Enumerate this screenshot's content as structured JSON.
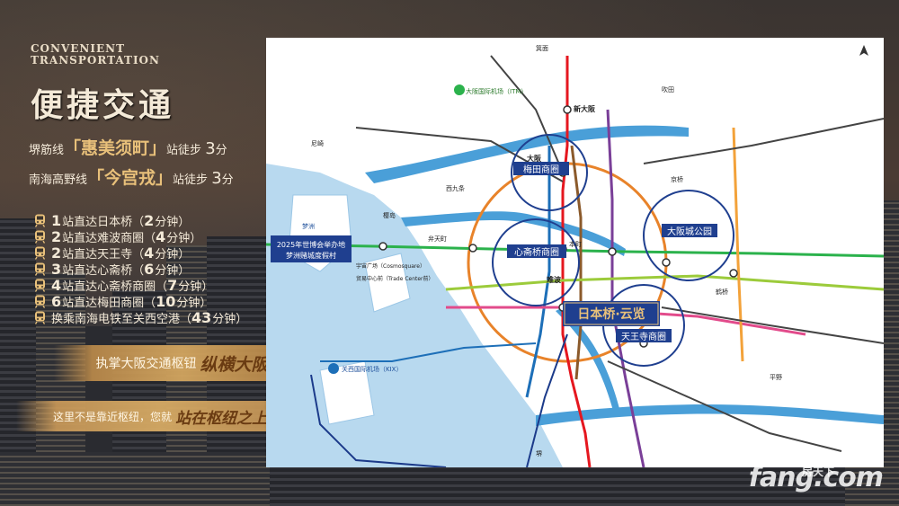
{
  "header": {
    "en_title_line1": "CONVENIENT",
    "en_title_line2": "TRANSPORTATION",
    "cn_title": "便捷交通"
  },
  "lines": [
    {
      "prefix": "堺筋线",
      "station": "「惠美须町」",
      "suffix": "站徒步",
      "minutes": "3",
      "unit": "分"
    },
    {
      "prefix": "南海高野线",
      "station": "「今宫戎」",
      "suffix": "站徒步",
      "minutes": "3",
      "unit": "分"
    }
  ],
  "stations": [
    {
      "count": "1",
      "text": "站直达日本桥（",
      "time": "2",
      "unit": "分钟）"
    },
    {
      "count": "2",
      "text": "站直达难波商圈（",
      "time": "4",
      "unit": "分钟）"
    },
    {
      "count": "2",
      "text": "站直达天王寺（",
      "time": "4",
      "unit": "分钟）"
    },
    {
      "count": "3",
      "text": "站直达心斋桥（",
      "time": "6",
      "unit": "分钟）"
    },
    {
      "count": "4",
      "text": "站直达心斋桥商圈（",
      "time": "7",
      "unit": "分钟）"
    },
    {
      "count": "6",
      "text": "站直达梅田商圈（",
      "time": "10",
      "unit": "分钟）"
    },
    {
      "count": "",
      "text": "换乘南海电铁至关西空港（",
      "time": "43",
      "unit": "分钟）"
    }
  ],
  "slogans": {
    "s1_plain": "执掌大阪交通枢钮",
    "s1_bold": "纵横大阪",
    "s2_plain": "这里不是靠近枢纽，您就",
    "s2_bold": "站在枢纽之上"
  },
  "map": {
    "labels": {
      "umeda": "梅田商圈",
      "shinsaibashi": "心斋桥商圈",
      "osaka_castle": "大阪城公园",
      "tennoji": "天王寺商圈",
      "nipponbashi": "日本桥·云览",
      "expo_line1": "2025年世博会举办地",
      "expo_line2": "梦洲赌城度假村",
      "itami_airport": "大阪国际机场（ITM）",
      "kix_airport": "关西国际机场（KIX）",
      "shin_osaka": "新大阪",
      "osaka": "大阪",
      "namba": "难波",
      "honmachi": "本町",
      "kyobashi": "京桥",
      "tsuruhashi": "鹤桥",
      "yumeshima": "梦洲",
      "cosmosquare": "宇宙广场（Cosmosquare）",
      "trade_center": "贸易中心前（Trade Center前）",
      "sakurajima": "樱岛",
      "bentencho": "弁天町",
      "nishikujo": "西九条",
      "amagasaki": "尼崎",
      "suita": "吹田",
      "minoo": "箕面",
      "sakai": "堺",
      "hirano": "平野"
    },
    "colors": {
      "midosuji_red": "#e5171f",
      "chuo_green": "#2bb24c",
      "sakaisuji_brown": "#8b5a2b",
      "tanimachi_purple": "#7a3f98",
      "yotsubashi_blue": "#1d6fb8",
      "jr_loop_orange": "#e8832a",
      "nankai_darkblue": "#1b3a8a",
      "water": "#4a9fd8",
      "circle_blue": "#1f3f8f"
    }
  },
  "watermark": {
    "main": "fang.com",
    "sub": "房天下"
  }
}
